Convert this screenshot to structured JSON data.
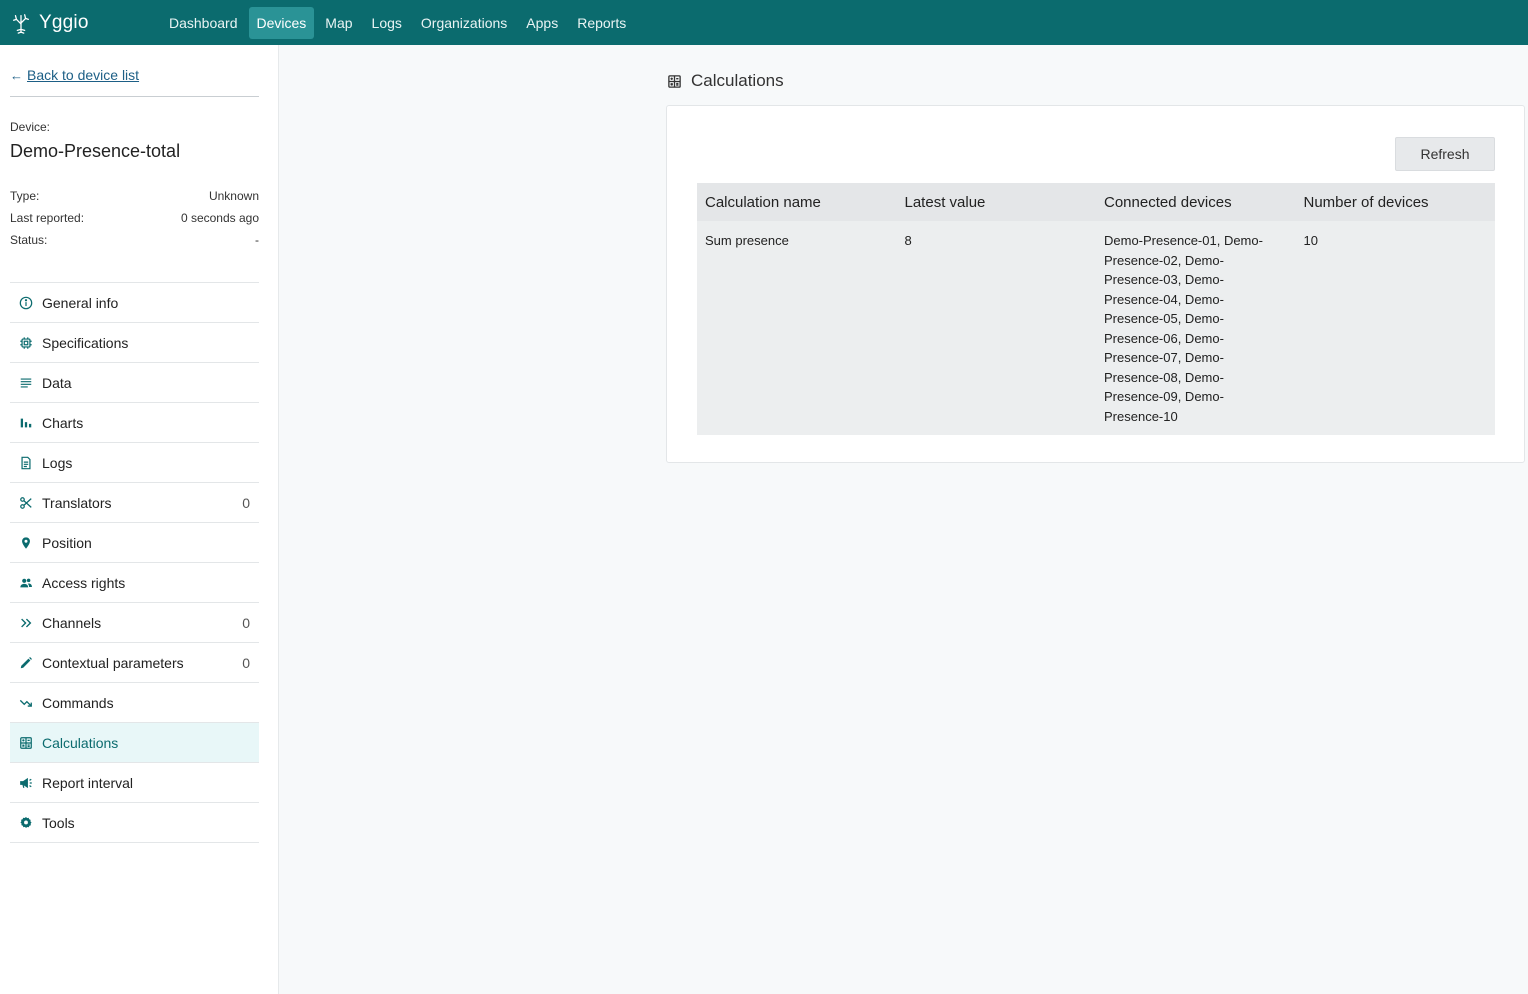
{
  "app": {
    "name": "Yggio",
    "logo_icon": "tree-logo-icon"
  },
  "nav": {
    "items": [
      {
        "label": "Dashboard",
        "active": false
      },
      {
        "label": "Devices",
        "active": true
      },
      {
        "label": "Map",
        "active": false
      },
      {
        "label": "Logs",
        "active": false
      },
      {
        "label": "Organizations",
        "active": false
      },
      {
        "label": "Apps",
        "active": false
      },
      {
        "label": "Reports",
        "active": false
      }
    ]
  },
  "sidebar": {
    "back_label": "Back to device list",
    "device_caption": "Device:",
    "device_name": "Demo-Presence-total",
    "meta": [
      {
        "label": "Type:",
        "value": "Unknown"
      },
      {
        "label": "Last reported:",
        "value": "0 seconds ago"
      },
      {
        "label": "Status:",
        "value": "-"
      }
    ],
    "menu": [
      {
        "label": "General info",
        "icon": "info-icon",
        "count": null
      },
      {
        "label": "Specifications",
        "icon": "chip-icon",
        "count": null
      },
      {
        "label": "Data",
        "icon": "lines-icon",
        "count": null
      },
      {
        "label": "Charts",
        "icon": "bar-chart-icon",
        "count": null
      },
      {
        "label": "Logs",
        "icon": "document-icon",
        "count": null
      },
      {
        "label": "Translators",
        "icon": "scissors-icon",
        "count": "0"
      },
      {
        "label": "Position",
        "icon": "location-pin-icon",
        "count": null
      },
      {
        "label": "Access rights",
        "icon": "users-icon",
        "count": null
      },
      {
        "label": "Channels",
        "icon": "double-chevron-icon",
        "count": "0"
      },
      {
        "label": "Contextual parameters",
        "icon": "pencil-icon",
        "count": "0"
      },
      {
        "label": "Commands",
        "icon": "trend-arrow-icon",
        "count": null
      },
      {
        "label": "Calculations",
        "icon": "calculator-icon",
        "count": null,
        "active": true
      },
      {
        "label": "Report interval",
        "icon": "broadcast-icon",
        "count": null
      },
      {
        "label": "Tools",
        "icon": "gear-icon",
        "count": null
      }
    ]
  },
  "main": {
    "title": "Calculations",
    "title_icon": "calculator-icon",
    "refresh_label": "Refresh",
    "table": {
      "headers": [
        "Calculation name",
        "Latest value",
        "Connected devices",
        "Number of devices"
      ],
      "rows": [
        {
          "name": "Sum presence",
          "latest_value": "8",
          "connected_devices": "Demo-Presence-01, Demo-Presence-02, Demo-Presence-03, Demo-Presence-04, Demo-Presence-05, Demo-Presence-06, Demo-Presence-07, Demo-Presence-08, Demo-Presence-09, Demo-Presence-10",
          "number_of_devices": "10"
        }
      ]
    }
  },
  "colors": {
    "topbar": "#0b6b6e",
    "nav_active": "#2a9396",
    "accent": "#0b6b6e",
    "link": "#1d5f86"
  }
}
